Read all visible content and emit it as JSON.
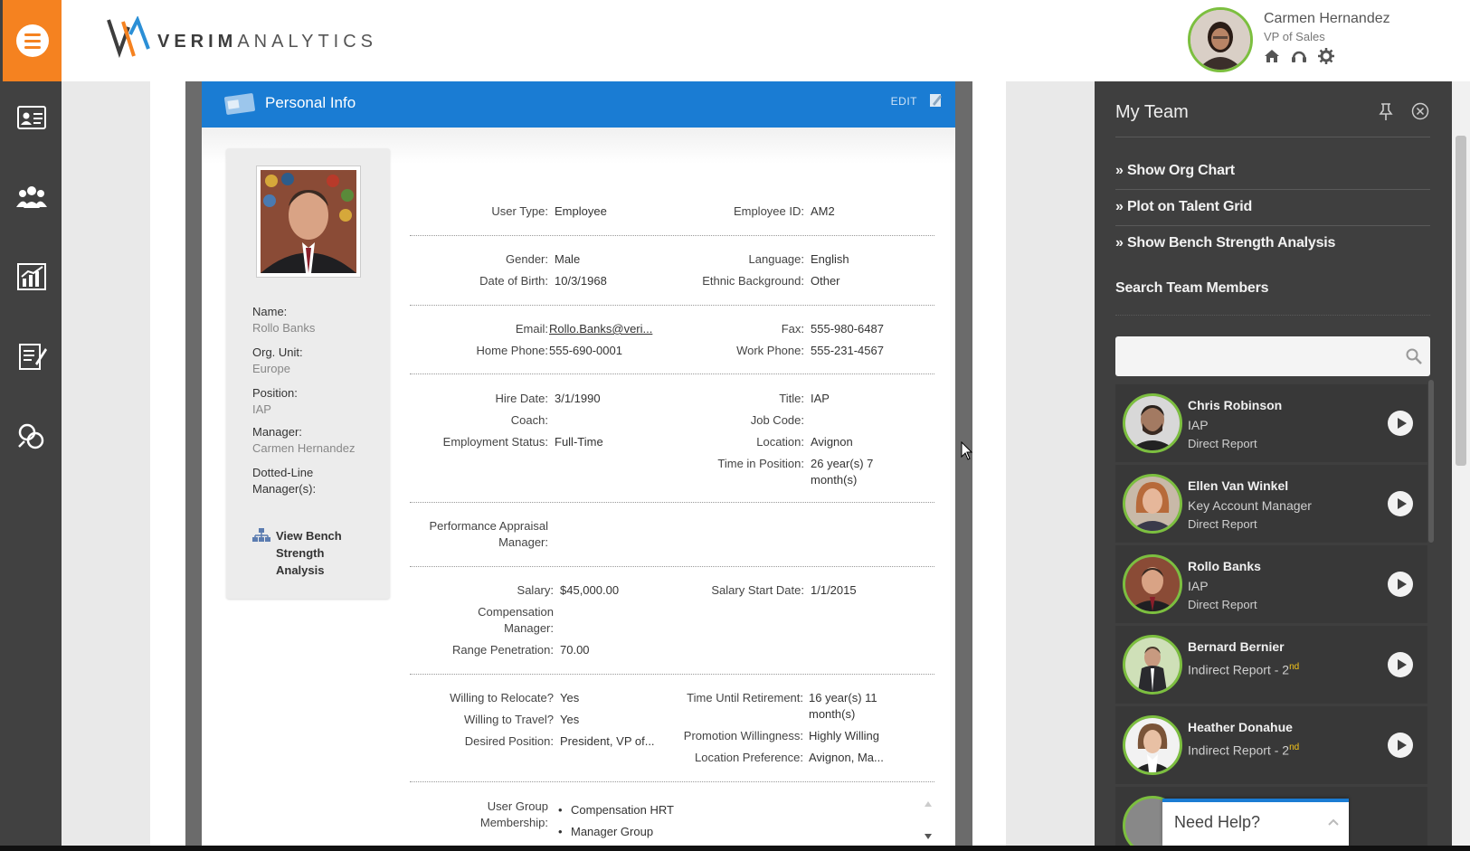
{
  "header": {
    "brand": {
      "logo_bold": "VERIM",
      "logo_rest": "ANALYTICS"
    },
    "user": {
      "name": "Carmen Hernandez",
      "title": "VP of Sales"
    }
  },
  "rail": {
    "icons": [
      "id-card-icon",
      "team-icon",
      "chart-icon",
      "notes-icon",
      "link-icon"
    ]
  },
  "card": {
    "title": "Personal Info",
    "edit_label": "EDIT"
  },
  "profile": {
    "name_label": "Name:",
    "name": "Rollo Banks",
    "org_label": "Org. Unit:",
    "org": "Europe",
    "position_label": "Position:",
    "position": "IAP",
    "manager_label": "Manager:",
    "manager": "Carmen Hernandez",
    "dotted_label_1": "Dotted-Line",
    "dotted_label_2": "Manager(s):",
    "bench_link": "View Bench Strength Analysis"
  },
  "fields": {
    "user_type_l": "User Type:",
    "user_type": "Employee",
    "emp_id_l": "Employee ID:",
    "emp_id": "AM2",
    "gender_l": "Gender:",
    "gender": "Male",
    "language_l": "Language:",
    "language": "English",
    "dob_l": "Date of Birth:",
    "dob": "10/3/1968",
    "ethnic_l": "Ethnic Background:",
    "ethnic": "Other",
    "email_l": "Email:",
    "email": "Rollo.Banks@veri...",
    "fax_l": "Fax:",
    "fax": "555-980-6487",
    "home_l": "Home Phone:",
    "home": "555-690-0001",
    "work_l": "Work Phone:",
    "work": "555-231-4567",
    "hire_l": "Hire Date:",
    "hire": "3/1/1990",
    "title_l": "Title:",
    "title": "IAP",
    "coach_l": "Coach:",
    "jobcode_l": "Job Code:",
    "status_l": "Employment Status:",
    "status": "Full-Time",
    "location_l": "Location:",
    "location": "Avignon",
    "tip_l": "Time in Position:",
    "tip_1": "26 year(s) 7",
    "tip_2": "month(s)",
    "pam_l1": "Performance Appraisal",
    "pam_l2": "Manager:",
    "salary_l": "Salary:",
    "salary": "$45,000.00",
    "ssd_l": "Salary Start Date:",
    "ssd": "1/1/2015",
    "comp_l1": "Compensation",
    "comp_l2": "Manager:",
    "range_l": "Range Penetration:",
    "range": "70.00",
    "relocate_l": "Willing to Relocate?",
    "relocate": "Yes",
    "tur_l": "Time Until Retirement:",
    "tur_1": "16 year(s) 11",
    "tur_2": "month(s)",
    "travel_l": "Willing to Travel?",
    "travel": "Yes",
    "promo_l": "Promotion Willingness:",
    "promo": "Highly Willing",
    "desired_l": "Desired Position:",
    "desired": "President, VP of...",
    "locpref_l": "Location Preference:",
    "locpref": "Avignon, Ma...",
    "ugm_l1": "User Group",
    "ugm_l2": "Membership:",
    "ugm_items": [
      "Compensation HRT",
      "Manager Group"
    ]
  },
  "team": {
    "title": "My Team",
    "links": [
      "» Show Org Chart",
      "» Plot on Talent Grid",
      "» Show Bench Strength Analysis"
    ],
    "search_heading": "Search Team Members",
    "search_placeholder": "",
    "members": [
      {
        "name": "Chris Robinson",
        "line2": "IAP",
        "line3": "Direct Report"
      },
      {
        "name": "Ellen Van Winkel",
        "line2": "Key Account Manager",
        "line3": "Direct Report"
      },
      {
        "name": "Rollo Banks",
        "line2": "IAP",
        "line3": "Direct Report"
      },
      {
        "name": "Bernard Bernier",
        "line2": "Indirect Report - 2",
        "sup": "nd"
      },
      {
        "name": "Heather Donahue",
        "line2": "Indirect Report - 2",
        "sup": "nd"
      }
    ]
  },
  "help": {
    "label": "Need Help?"
  },
  "colors": {
    "accent_orange": "#f58220",
    "header_blue": "#1a7cd3",
    "panel_dark": "#3f3f3f",
    "avatar_ring": "#7cbf3f"
  }
}
